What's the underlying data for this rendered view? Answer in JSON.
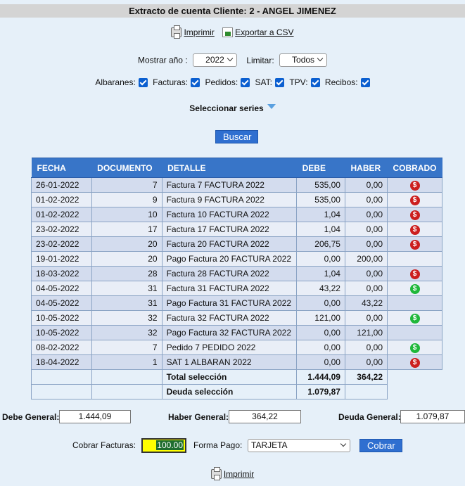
{
  "header": {
    "title": "Extracto de cuenta Cliente: 2 - ANGEL JIMENEZ"
  },
  "actions": {
    "print": "Imprimir",
    "export_csv": "Exportar a CSV"
  },
  "filters": {
    "year_label": "Mostrar año :",
    "year_value": "2022",
    "limit_label": "Limitar:",
    "limit_value": "Todos"
  },
  "checks": [
    {
      "label": "Albaranes:",
      "checked": true
    },
    {
      "label": "Facturas:",
      "checked": true
    },
    {
      "label": "Pedidos:",
      "checked": true
    },
    {
      "label": "SAT:",
      "checked": true
    },
    {
      "label": "TPV:",
      "checked": true
    },
    {
      "label": "Recibos:",
      "checked": true
    }
  ],
  "series_label": "Seleccionar series",
  "search_button": "Buscar",
  "table": {
    "headers": [
      "FECHA",
      "DOCUMENTO",
      "DETALLE",
      "DEBE",
      "HABER",
      "COBRADO"
    ],
    "rows": [
      [
        "26-01-2022",
        "7",
        "Factura 7 FACTURA 2022",
        "535,00",
        "0,00",
        "red"
      ],
      [
        "01-02-2022",
        "9",
        "Factura 9 FACTURA 2022",
        "535,00",
        "0,00",
        "red"
      ],
      [
        "01-02-2022",
        "10",
        "Factura 10 FACTURA 2022",
        "1,04",
        "0,00",
        "red"
      ],
      [
        "23-02-2022",
        "17",
        "Factura 17 FACTURA 2022",
        "1,04",
        "0,00",
        "red"
      ],
      [
        "23-02-2022",
        "20",
        "Factura 20 FACTURA 2022",
        "206,75",
        "0,00",
        "red"
      ],
      [
        "19-01-2022",
        "20",
        "Pago Factura 20 FACTURA 2022",
        "0,00",
        "200,00",
        ""
      ],
      [
        "18-03-2022",
        "28",
        "Factura 28 FACTURA 2022",
        "1,04",
        "0,00",
        "red"
      ],
      [
        "04-05-2022",
        "31",
        "Factura 31 FACTURA 2022",
        "43,22",
        "0,00",
        "green"
      ],
      [
        "04-05-2022",
        "31",
        "Pago Factura 31 FACTURA 2022",
        "0,00",
        "43,22",
        ""
      ],
      [
        "10-05-2022",
        "32",
        "Factura 32 FACTURA 2022",
        "121,00",
        "0,00",
        "green"
      ],
      [
        "10-05-2022",
        "32",
        "Pago Factura 32 FACTURA 2022",
        "0,00",
        "121,00",
        ""
      ],
      [
        "08-02-2022",
        "7",
        "Pedido 7 PEDIDO 2022",
        "0,00",
        "0,00",
        "green"
      ],
      [
        "18-04-2022",
        "1",
        "SAT 1 ALBARAN 2022",
        "0,00",
        "0,00",
        "red"
      ]
    ],
    "total_label": "Total selección",
    "total_debe": "1.444,09",
    "total_haber": "364,22",
    "deuda_label": "Deuda selección",
    "deuda_value": "1.079,87"
  },
  "totals": {
    "debe_label": "Debe General:",
    "debe_value": "1.444,09",
    "haber_label": "Haber General:",
    "haber_value": "364,22",
    "deuda_label": "Deuda General:",
    "deuda_value": "1.079,87"
  },
  "cobrar": {
    "label": "Cobrar Facturas:",
    "amount": "100.00",
    "forma_label": "Forma Pago:",
    "forma_value": "TARJETA",
    "button": "Cobrar"
  },
  "bottom": {
    "print": "Imprimir"
  },
  "colors": {
    "header_blue": "#3875c8",
    "button_blue": "#2f6fd0",
    "status_red": "#cc1f1f",
    "status_green": "#1fb83a",
    "amount_highlight": "#ffff00"
  }
}
